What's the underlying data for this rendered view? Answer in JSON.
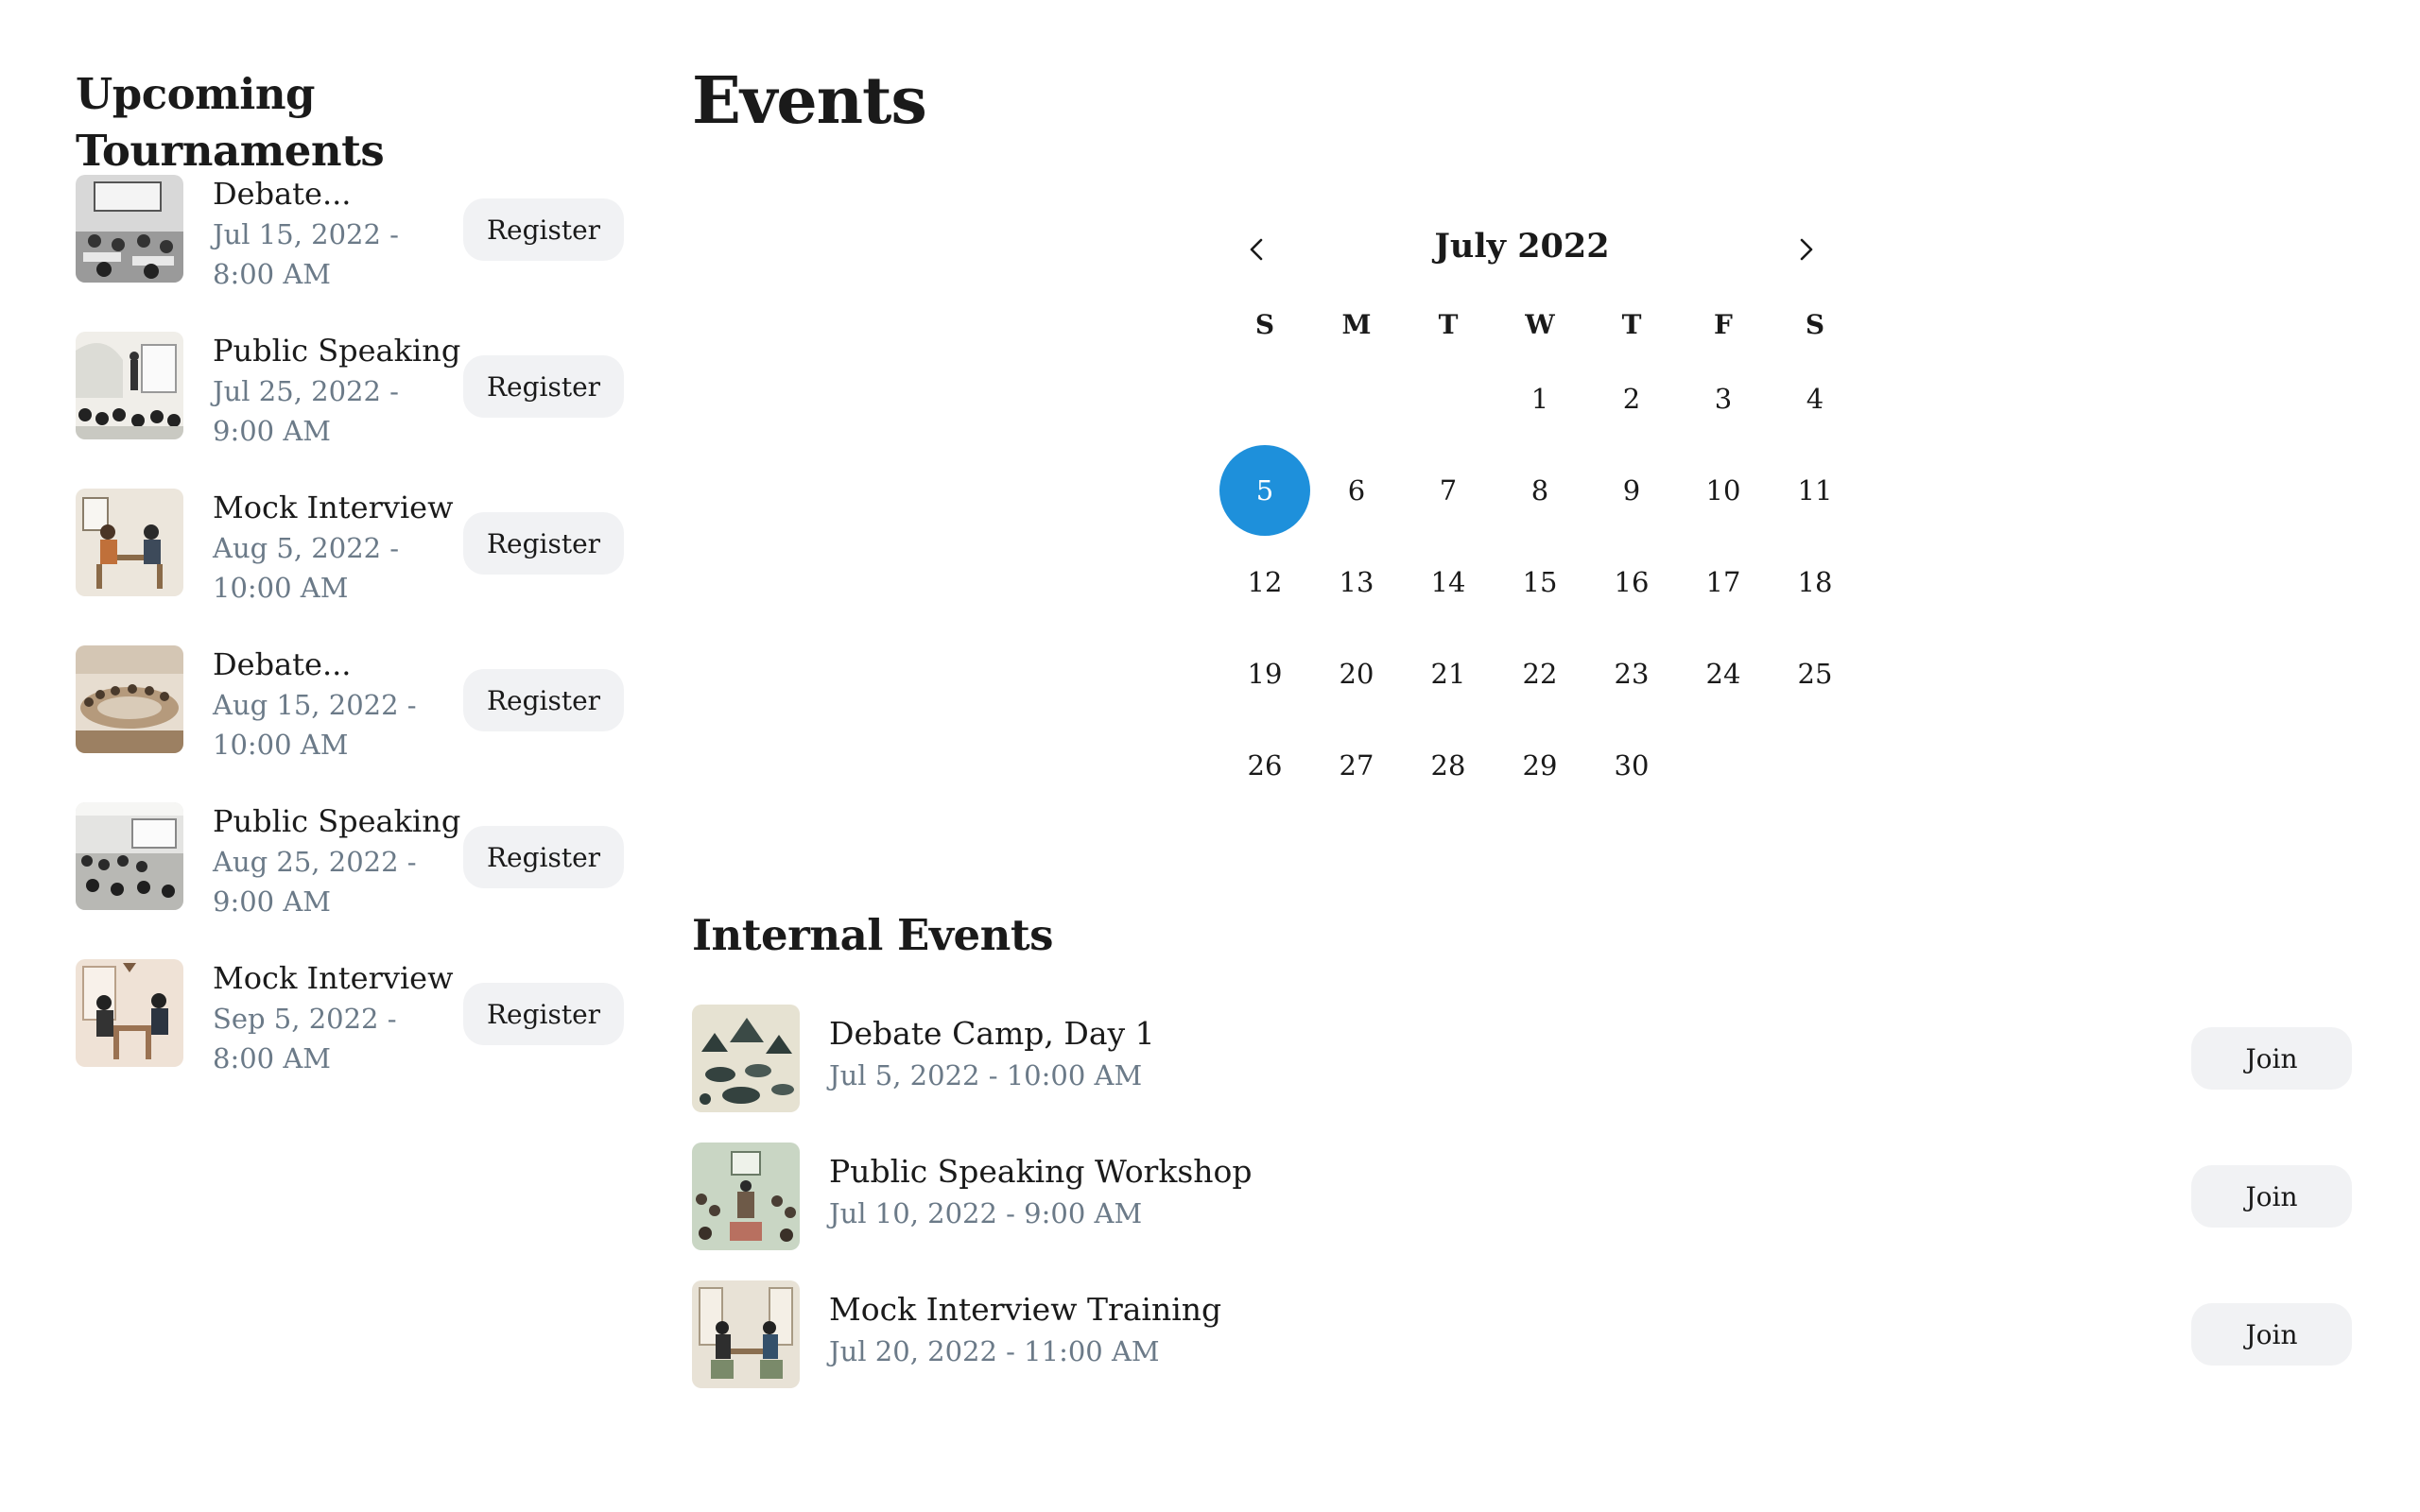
{
  "sidebar": {
    "title": "Upcoming Tournaments",
    "tournaments": [
      {
        "name": "Debate...",
        "date": "Jul 15, 2022 - 8:00 AM",
        "button": "Register",
        "thumb": "debate-classroom-image"
      },
      {
        "name": "Public Speaking",
        "date": "Jul 25, 2022 - 9:00 AM",
        "button": "Register",
        "thumb": "public-speaking-image"
      },
      {
        "name": "Mock Interview",
        "date": "Aug 5, 2022 - 10:00 AM",
        "button": "Register",
        "thumb": "mock-interview-image"
      },
      {
        "name": "Debate...",
        "date": "Aug 15, 2022 - 10:00 AM",
        "button": "Register",
        "thumb": "debate-hall-image"
      },
      {
        "name": "Public Speaking",
        "date": "Aug 25, 2022 - 9:00 AM",
        "button": "Register",
        "thumb": "lecture-hall-image"
      },
      {
        "name": "Mock Interview",
        "date": "Sep 5, 2022 - 8:00 AM",
        "button": "Register",
        "thumb": "interview-room-image"
      }
    ]
  },
  "main": {
    "title": "Events",
    "calendar": {
      "month_label": "July 2022",
      "prev_icon": "chevron-left-icon",
      "next_icon": "chevron-right-icon",
      "weekdays": [
        "S",
        "M",
        "T",
        "W",
        "T",
        "F",
        "S"
      ],
      "first_weekday_index": 3,
      "days_in_month": 30,
      "selected_day": 5,
      "selected_color": "#1e90db"
    },
    "internal_title": "Internal Events",
    "internal_events": [
      {
        "name": "Debate Camp, Day 1",
        "date": "Jul 5, 2022 - 10:00 AM",
        "button": "Join",
        "thumb": "camp-image"
      },
      {
        "name": "Public Speaking Workshop",
        "date": "Jul 10, 2022 - 9:00 AM",
        "button": "Join",
        "thumb": "workshop-image"
      },
      {
        "name": "Mock Interview Training",
        "date": "Jul 20, 2022 - 11:00 AM",
        "button": "Join",
        "thumb": "interview-training-image"
      }
    ]
  }
}
